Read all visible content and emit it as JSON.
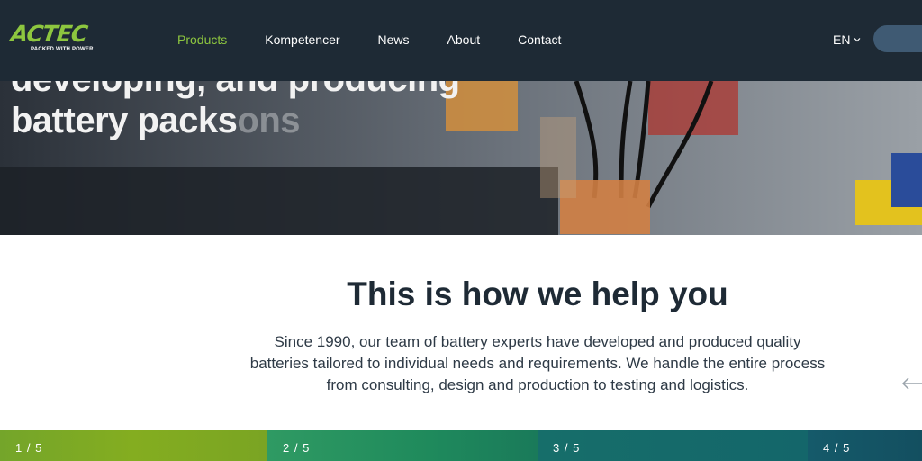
{
  "logo": {
    "word": "ACTEC",
    "tagline": "PACKED WITH POWER"
  },
  "nav": {
    "items": [
      {
        "label": "Products",
        "active": true
      },
      {
        "label": "Kompetencer",
        "active": false
      },
      {
        "label": "News",
        "active": false
      },
      {
        "label": "About",
        "active": false
      },
      {
        "label": "Contact",
        "active": false
      }
    ]
  },
  "language": {
    "label": "EN",
    "icon": "chevron-down-icon"
  },
  "hero": {
    "line1": "developing, and producing",
    "line2": "battery packs",
    "line2_ghost": "ons"
  },
  "help": {
    "title": "This is how we help you",
    "text": "Since 1990, our team of battery experts have developed and produced quality batteries tailored to individual needs and requirements. We handle the entire process from consulting, design and production to testing and logistics."
  },
  "carousel": {
    "prev_icon": "arrow-left-icon"
  },
  "slides": [
    {
      "label": "1 / 5"
    },
    {
      "label": "2 / 5"
    },
    {
      "label": "3 / 5"
    },
    {
      "label": "4 / 5"
    }
  ],
  "colors": {
    "header_bg": "#1e2a35",
    "brand_green": "#8dc63f",
    "title_color": "#1e2a35"
  }
}
